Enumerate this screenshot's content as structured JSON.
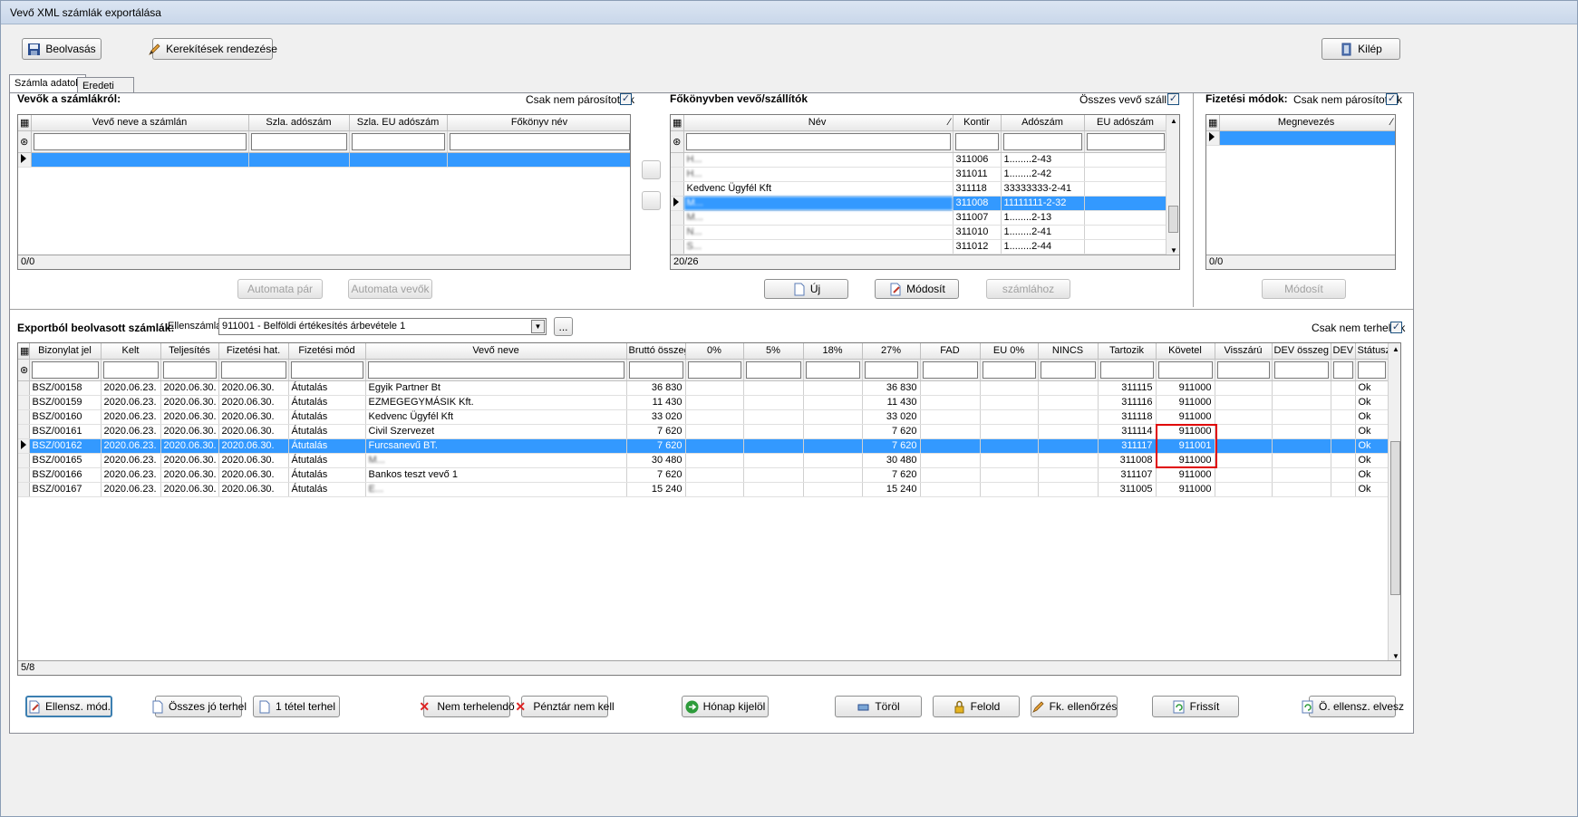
{
  "window": {
    "title": "Vevő XML számlák exportálása"
  },
  "toolbar": {
    "read_label": "Beolvasás",
    "rounding_label": "Kerekítések rendezése",
    "exit_label": "Kilép"
  },
  "tabs": [
    {
      "label": "Számla adatok"
    },
    {
      "label": "Eredeti tábla"
    }
  ],
  "buyers": {
    "title": "Vevők a számlákról:",
    "only_unpaired_label": "Csak nem párosítottak",
    "only_unpaired_checked": true,
    "columns": [
      "Vevő neve a számlán",
      "Szla. adószám",
      "Szla. EU adószám",
      "Főkönyv név"
    ],
    "count": "0/0",
    "auto_pair_label": "Automata pár",
    "auto_buyers_label": "Automata vevők"
  },
  "ledger": {
    "title": "Főkönyvben vevő/szállítók",
    "all_label": "Összes vevő szállító",
    "all_checked": true,
    "columns": [
      "Név",
      "Kontir",
      "Adószám",
      "EU adószám"
    ],
    "rows": [
      {
        "name": "H...",
        "kontir": "311006",
        "tax": "1........2-43"
      },
      {
        "name": "H...",
        "kontir": "311011",
        "tax": "1........2-42"
      },
      {
        "name": "Kedvenc Ügyfél Kft",
        "kontir": "311118",
        "tax": "33333333-2-41"
      },
      {
        "name": "M...",
        "kontir": "311008",
        "tax": "11111111-2-32",
        "selected": true
      },
      {
        "name": "M...",
        "kontir": "311007",
        "tax": "1........2-13"
      },
      {
        "name": "N...",
        "kontir": "311010",
        "tax": "1........2-41"
      },
      {
        "name": "S...",
        "kontir": "311012",
        "tax": "1........2-44"
      }
    ],
    "count": "20/26",
    "new_label": "Új",
    "modify_label": "Módosít",
    "to_invoice_label": "számlához"
  },
  "payment": {
    "title": "Fizetési módok:",
    "only_unpaired_label": "Csak nem párosítottak",
    "only_unpaired_checked": true,
    "columns": [
      "Megnevezés"
    ],
    "count": "0/0",
    "modify_label": "Módosít"
  },
  "invoices": {
    "title": "Exportból beolvasott számlák:",
    "counter_account_label": "Ellenszámla:",
    "counter_account_value": "911001 - Belföldi értékesítés árbevétele 1",
    "browse_label": "...",
    "only_unposted_label": "Csak nem terheltek",
    "only_unposted_checked": true,
    "columns": [
      "Bizonylat jel",
      "Kelt",
      "Teljesítés",
      "Fizetési hat.",
      "Fizetési mód",
      "Vevő neve",
      "Bruttó összeg",
      "0%",
      "5%",
      "18%",
      "27%",
      "FAD",
      "EU 0%",
      "NINCS",
      "Tartozik",
      "Követel",
      "Visszárú",
      "DEV összeg",
      "DEV",
      "Státusz"
    ],
    "rows": [
      {
        "doc": "BSZ/00158",
        "date": "2020.06.23.",
        "perf": "2020.06.30.",
        "due": "2020.06.30.",
        "method": "Átutalás",
        "name": "Egyik Partner Bt",
        "gross": "36 830",
        "v27": "36 830",
        "debit": "311115",
        "credit": "911000",
        "status": "Ok"
      },
      {
        "doc": "BSZ/00159",
        "date": "2020.06.23.",
        "perf": "2020.06.30.",
        "due": "2020.06.30.",
        "method": "Átutalás",
        "name": "EZMEGEGYMÁSIK Kft.",
        "gross": "11 430",
        "v27": "11 430",
        "debit": "311116",
        "credit": "911000",
        "status": "Ok"
      },
      {
        "doc": "BSZ/00160",
        "date": "2020.06.23.",
        "perf": "2020.06.30.",
        "due": "2020.06.30.",
        "method": "Átutalás",
        "name": "Kedvenc Ügyfél Kft",
        "gross": "33 020",
        "v27": "33 020",
        "debit": "311118",
        "credit": "911000",
        "status": "Ok"
      },
      {
        "doc": "BSZ/00161",
        "date": "2020.06.23.",
        "perf": "2020.06.30.",
        "due": "2020.06.30.",
        "method": "Átutalás",
        "name": "Civil Szervezet",
        "gross": "7 620",
        "v27": "7 620",
        "debit": "311114",
        "credit": "911000",
        "status": "Ok"
      },
      {
        "doc": "BSZ/00162",
        "date": "2020.06.23.",
        "perf": "2020.06.30.",
        "due": "2020.06.30.",
        "method": "Átutalás",
        "name": "Furcsanevű BT.",
        "gross": "7 620",
        "v27": "7 620",
        "debit": "311117",
        "credit": "911001",
        "status": "Ok",
        "selected": true
      },
      {
        "doc": "BSZ/00165",
        "date": "2020.06.23.",
        "perf": "2020.06.30.",
        "due": "2020.06.30.",
        "method": "Átutalás",
        "name": "M...",
        "gross": "30 480",
        "v27": "30 480",
        "debit": "311008",
        "credit": "911000",
        "status": "Ok",
        "blur": true
      },
      {
        "doc": "BSZ/00166",
        "date": "2020.06.23.",
        "perf": "2020.06.30.",
        "due": "2020.06.30.",
        "method": "Átutalás",
        "name": "Bankos teszt vevő 1",
        "gross": "7 620",
        "v27": "7 620",
        "debit": "311107",
        "credit": "911000",
        "status": "Ok"
      },
      {
        "doc": "BSZ/00167",
        "date": "2020.06.23.",
        "perf": "2020.06.30.",
        "due": "2020.06.30.",
        "method": "Átutalás",
        "name": "E...",
        "gross": "15 240",
        "v27": "15 240",
        "debit": "311005",
        "credit": "911000",
        "status": "Ok",
        "blur": true
      }
    ],
    "count": "5/8"
  },
  "bottom_buttons": {
    "counter_mod": "Ellensz. mód.",
    "all_good_post": "Összes jó terhel",
    "one_item_post": "1 tétel terhel",
    "not_to_post": "Nem terhelendő",
    "cash_not_needed": "Pénztár nem kell",
    "month_select": "Hónap kijelöl",
    "delete": "Töröl",
    "release": "Felold",
    "ledger_check": "Fk. ellenőrzés",
    "refresh": "Frissít",
    "all_counter_lost": "Ö. ellensz. elvesz"
  },
  "colors": {
    "selection": "#3399ff",
    "highlight_box": "#e00000"
  }
}
